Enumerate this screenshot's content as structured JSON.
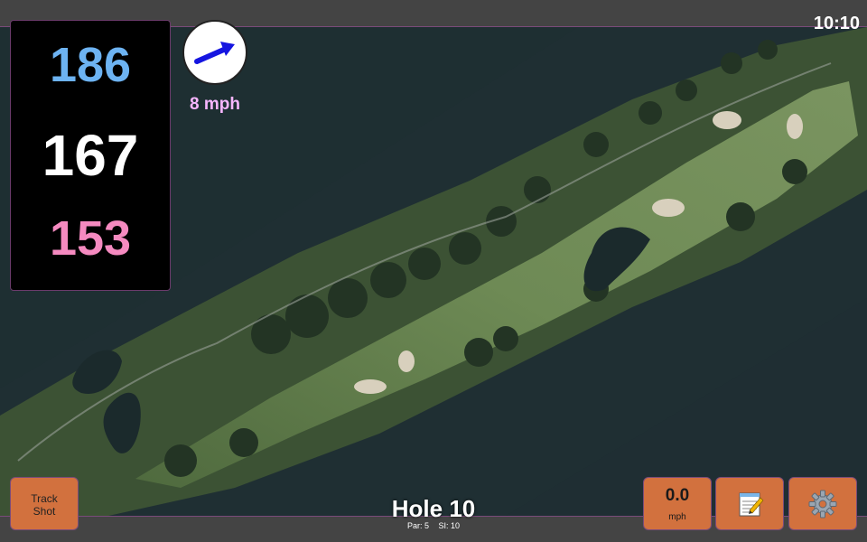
{
  "status": {
    "time": "10:10"
  },
  "distances": {
    "back": "186",
    "middle": "167",
    "front": "153"
  },
  "wind": {
    "speed_label": "8 mph",
    "direction": "east-northeast"
  },
  "hole": {
    "title": "Hole 10",
    "par": "Par: 5",
    "stroke_index": "SI: 10"
  },
  "buttons": {
    "track_shot": {
      "line1": "Track",
      "line2": "Shot"
    },
    "wind_speed": {
      "value": "0.0",
      "unit": "mph"
    },
    "notes": {
      "icon": "notepad-icon"
    },
    "settings": {
      "icon": "gear-icon"
    }
  },
  "colors": {
    "back_distance": "#6db3f2",
    "middle_distance": "#ffffff",
    "front_distance": "#f58ac0",
    "wind_text": "#f7b6ff",
    "button_bg": "#d2713e",
    "bar_bg": "#444444",
    "panel_bg": "#000000"
  }
}
